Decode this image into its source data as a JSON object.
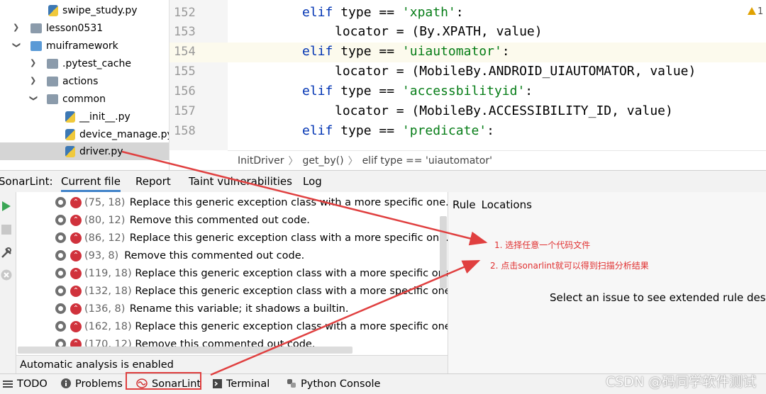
{
  "project_tree": {
    "items": [
      {
        "label": "swipe_study.py",
        "type": "python-file"
      },
      {
        "label": "lesson0531",
        "type": "folder",
        "expanded": false
      },
      {
        "label": "muiframework",
        "type": "folder",
        "expanded": true
      },
      {
        "label": ".pytest_cache",
        "type": "folder",
        "expanded": false
      },
      {
        "label": "actions",
        "type": "folder",
        "expanded": false
      },
      {
        "label": "common",
        "type": "folder",
        "expanded": true
      },
      {
        "label": "__init__.py",
        "type": "python-file"
      },
      {
        "label": "device_manage.py",
        "type": "python-file"
      },
      {
        "label": "driver.py",
        "type": "python-file",
        "selected": true
      }
    ]
  },
  "editor": {
    "lines": [
      {
        "num": "152",
        "parts": [
          [
            "kw",
            "elif"
          ],
          [
            "",
            "type == "
          ],
          [
            "str",
            "'xpath'"
          ],
          [
            "",
            ":"
          ]
        ]
      },
      {
        "num": "153",
        "parts": [
          [
            "",
            "locator = (By.XPATH, value)"
          ]
        ]
      },
      {
        "num": "154",
        "parts": [
          [
            "kw",
            "elif"
          ],
          [
            "",
            "type == "
          ],
          [
            "str",
            "'uiautomator'"
          ],
          [
            "",
            ":"
          ]
        ]
      },
      {
        "num": "155",
        "parts": [
          [
            "",
            "locator = (MobileBy.ANDROID_UIAUTOMATOR, value)"
          ]
        ]
      },
      {
        "num": "156",
        "parts": [
          [
            "kw",
            "elif"
          ],
          [
            "",
            "type == "
          ],
          [
            "str",
            "'accessbilityid'"
          ],
          [
            "",
            ":"
          ]
        ]
      },
      {
        "num": "157",
        "parts": [
          [
            "",
            "locator = (MobileBy.ACCESSIBILITY_ID, value)"
          ]
        ]
      },
      {
        "num": "158",
        "parts": [
          [
            "kw",
            "elif"
          ],
          [
            "",
            "type == "
          ],
          [
            "str",
            "'predicate'"
          ],
          [
            "",
            ":"
          ]
        ]
      }
    ],
    "warning_count": "1"
  },
  "breadcrumb": {
    "items": [
      "InitDriver",
      "get_by()",
      "elif type == 'uiautomator'"
    ]
  },
  "sonarlint": {
    "title": "SonarLint:",
    "tabs": [
      "Current file",
      "Report",
      "Taint vulnerabilities",
      "Log"
    ],
    "active_tab": "Current file",
    "issues": [
      {
        "pos": "(75, 18)",
        "message": "Replace this generic exception class with a more specific one."
      },
      {
        "pos": "(80, 12)",
        "message": "Remove this commented out code."
      },
      {
        "pos": "(86, 12)",
        "message": "Replace this generic exception class with a more specific one."
      },
      {
        "pos": "(93, 8)",
        "message": "Remove this commented out code."
      },
      {
        "pos": "(119, 18)",
        "message": "Replace this generic exception class with a more specific one."
      },
      {
        "pos": "(132, 18)",
        "message": "Replace this generic exception class with a more specific one."
      },
      {
        "pos": "(136, 8)",
        "message": "Rename this variable; it shadows a builtin."
      },
      {
        "pos": "(162, 18)",
        "message": "Replace this generic exception class with a more specific one."
      },
      {
        "pos": "(170, 12)",
        "message": "Remove this commented out code."
      }
    ],
    "status": "Automatic analysis is enabled",
    "rule_tabs": [
      "Rule",
      "Locations"
    ],
    "rule_placeholder": "Select an issue to see extended rule descriptio"
  },
  "annotations": {
    "step1": "1. 选择任意一个代码文件",
    "step2": "2. 点击sonarlint就可以得到扫描分析结果",
    "color": "#e03030"
  },
  "bottom_bar": {
    "items": [
      "TODO",
      "Problems",
      "SonarLint",
      "Terminal",
      "Python Console"
    ]
  },
  "watermark": "CSDN @码同学软件测试",
  "colors": {
    "keyword": "#0033b3",
    "string": "#067d17",
    "selection": "#d5d5d5",
    "tab_underline": "#4083c9",
    "severity": "#d0323c"
  }
}
